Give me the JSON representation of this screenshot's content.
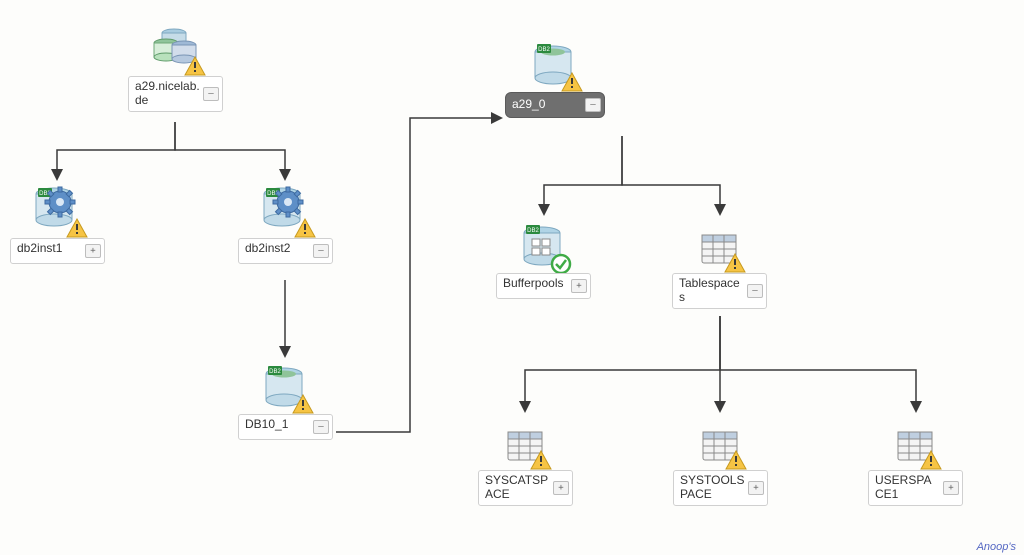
{
  "nodes": {
    "root": {
      "label": "a29.nicelab.de",
      "type": "server-cluster",
      "status": "warning",
      "expand": "collapse"
    },
    "db2inst1": {
      "label": "db2inst1",
      "type": "instance",
      "status": "warning",
      "expand": "plus"
    },
    "db2inst2": {
      "label": "db2inst2",
      "type": "instance",
      "status": "warning",
      "expand": "collapse"
    },
    "db10_1": {
      "label": "DB10_1",
      "type": "database",
      "status": "warning",
      "expand": "collapse"
    },
    "a29_0": {
      "label": "a29_0",
      "type": "database",
      "status": "warning",
      "expand": "collapse"
    },
    "bufferpools": {
      "label": "Bufferpools",
      "type": "bufferpool",
      "status": "ok",
      "expand": "plus"
    },
    "tablespaces": {
      "label": "Tablespaces",
      "type": "tablespace-grp",
      "status": "warning",
      "expand": "collapse"
    },
    "syscat": {
      "label": "SYSCATSPACE",
      "type": "tablespace",
      "status": "warning",
      "expand": "plus"
    },
    "systool": {
      "label": "SYSTOOLSPACE",
      "type": "tablespace",
      "status": "warning",
      "expand": "plus"
    },
    "userspace": {
      "label": "USERSPACE1",
      "type": "tablespace",
      "status": "warning",
      "expand": "plus"
    }
  },
  "edges": [
    [
      "root",
      "db2inst1"
    ],
    [
      "root",
      "db2inst2"
    ],
    [
      "db2inst2",
      "db10_1"
    ],
    [
      "db10_1",
      "a29_0"
    ],
    [
      "a29_0",
      "bufferpools"
    ],
    [
      "a29_0",
      "tablespaces"
    ],
    [
      "tablespaces",
      "syscat"
    ],
    [
      "tablespaces",
      "systool"
    ],
    [
      "tablespaces",
      "userspace"
    ]
  ],
  "watermark": "Anoop's"
}
